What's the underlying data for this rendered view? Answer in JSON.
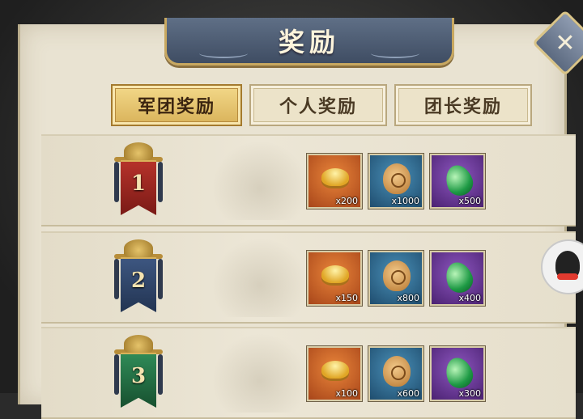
{
  "title": "奖励",
  "close_symbol": "✕",
  "tabs": [
    {
      "label": "军团奖励",
      "active": true
    },
    {
      "label": "个人奖励",
      "active": false
    },
    {
      "label": "团长奖励",
      "active": false
    }
  ],
  "ranks": [
    {
      "rank": "1",
      "banner_color": "red",
      "rewards": [
        {
          "icon": "gold-ingot-icon",
          "count": "x200"
        },
        {
          "icon": "coin-bag-icon",
          "count": "x1000"
        },
        {
          "icon": "green-gem-icon",
          "count": "x500"
        }
      ]
    },
    {
      "rank": "2",
      "banner_color": "blue",
      "rewards": [
        {
          "icon": "gold-ingot-icon",
          "count": "x150"
        },
        {
          "icon": "coin-bag-icon",
          "count": "x800"
        },
        {
          "icon": "green-gem-icon",
          "count": "x400"
        }
      ]
    },
    {
      "rank": "3",
      "banner_color": "green",
      "rewards": [
        {
          "icon": "gold-ingot-icon",
          "count": "x100"
        },
        {
          "icon": "coin-bag-icon",
          "count": "x600"
        },
        {
          "icon": "green-gem-icon",
          "count": "x300"
        }
      ]
    }
  ]
}
